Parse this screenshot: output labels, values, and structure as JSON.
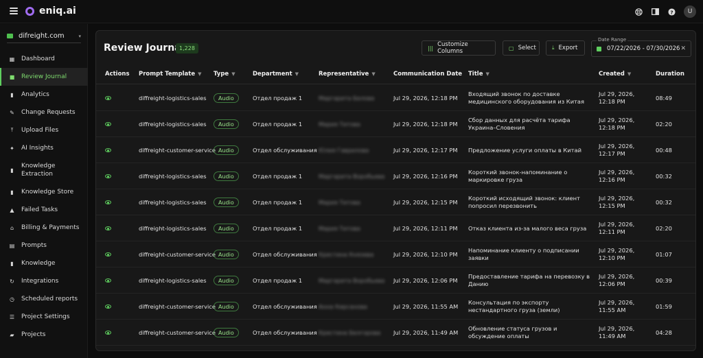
{
  "app": {
    "brand": "eniq.ai",
    "avatar_initial": "U"
  },
  "topbar_icons": [
    "support-icon",
    "split-view-icon",
    "help-icon"
  ],
  "sidebar": {
    "workspace": "difreight.com",
    "items": [
      {
        "label": "Dashboard",
        "icon": "dashboard-icon",
        "active": false
      },
      {
        "label": "Review Journal",
        "icon": "journal-icon",
        "active": true
      },
      {
        "label": "Analytics",
        "icon": "bar-chart-icon",
        "active": false
      },
      {
        "label": "Change Requests",
        "icon": "pencil-icon",
        "active": false
      },
      {
        "label": "Upload Files",
        "icon": "upload-icon",
        "active": false
      },
      {
        "label": "AI Insights",
        "icon": "sparkle-icon",
        "active": false
      },
      {
        "label": "Knowledge Extraction",
        "icon": "book-icon",
        "active": false
      },
      {
        "label": "Knowledge Store",
        "icon": "book-icon",
        "active": false
      },
      {
        "label": "Failed Tasks",
        "icon": "warning-icon",
        "active": false
      },
      {
        "label": "Billing & Payments",
        "icon": "bank-icon",
        "active": false
      },
      {
        "label": "Prompts",
        "icon": "document-icon",
        "active": false
      },
      {
        "label": "Knowledge",
        "icon": "book-icon",
        "active": false
      },
      {
        "label": "Integrations",
        "icon": "refresh-icon",
        "active": false
      },
      {
        "label": "Scheduled reports",
        "icon": "clock-icon",
        "active": false
      },
      {
        "label": "Project Settings",
        "icon": "sliders-icon",
        "active": false
      },
      {
        "label": "Projects",
        "icon": "folder-icon",
        "active": false
      }
    ]
  },
  "header": {
    "title": "Review Journal",
    "count": "1,228",
    "customize_label": "Customize Columns",
    "select_label": "Select",
    "export_label": "Export",
    "date_range_label": "Date Range",
    "date_range_value": "07/22/2026 - 07/30/2026"
  },
  "table": {
    "columns": {
      "actions": "Actions",
      "prompt_template": "Prompt Template",
      "type": "Type",
      "department": "Department",
      "representative": "Representative",
      "communication_date": "Communication Date",
      "title": "Title",
      "created": "Created",
      "duration": "Duration"
    },
    "rows": [
      {
        "prompt": "diffreight-logistics-sales",
        "type": "Audio",
        "dept": "Отдел продаж 1",
        "rep": "Маргарита Белова",
        "date": "Jul 29, 2026, 12:18 PM",
        "title": "Входящий звонок по доставке медицинского оборудования из Китая",
        "created": "Jul 29, 2026, 12:18 PM",
        "duration": "08:49"
      },
      {
        "prompt": "diffreight-logistics-sales",
        "type": "Audio",
        "dept": "Отдел продаж 1",
        "rep": "Мария Титова",
        "date": "Jul 29, 2026, 12:18 PM",
        "title": "Сбор данных для расчёта тарифа Украина–Словения",
        "created": "Jul 29, 2026, 12:18 PM",
        "duration": "02:20"
      },
      {
        "prompt": "diffreight-customer-service",
        "type": "Audio",
        "dept": "Отдел обслуживания",
        "rep": "Юлия Гаврилова",
        "date": "Jul 29, 2026, 12:17 PM",
        "title": "Предложение услуги оплаты в Китай",
        "created": "Jul 29, 2026, 12:17 PM",
        "duration": "00:48"
      },
      {
        "prompt": "diffreight-logistics-sales",
        "type": "Audio",
        "dept": "Отдел продаж 1",
        "rep": "Маргарита Воробьева",
        "date": "Jul 29, 2026, 12:16 PM",
        "title": "Короткий звонок-напоминание о маркировке груза",
        "created": "Jul 29, 2026, 12:16 PM",
        "duration": "00:32"
      },
      {
        "prompt": "diffreight-logistics-sales",
        "type": "Audio",
        "dept": "Отдел продаж 1",
        "rep": "Мария Титова",
        "date": "Jul 29, 2026, 12:15 PM",
        "title": "Короткий исходящий звонок: клиент попросил перезвонить",
        "created": "Jul 29, 2026, 12:15 PM",
        "duration": "00:32"
      },
      {
        "prompt": "diffreight-logistics-sales",
        "type": "Audio",
        "dept": "Отдел продаж 1",
        "rep": "Мария Титова",
        "date": "Jul 29, 2026, 12:11 PM",
        "title": "Отказ клиента из-за малого веса груза",
        "created": "Jul 29, 2026, 12:11 PM",
        "duration": "02:20"
      },
      {
        "prompt": "diffreight-customer-service",
        "type": "Audio",
        "dept": "Отдел обслуживания",
        "rep": "Кристина Князева",
        "date": "Jul 29, 2026, 12:10 PM",
        "title": "Напоминание клиенту о подписании заявки",
        "created": "Jul 29, 2026, 12:10 PM",
        "duration": "01:07"
      },
      {
        "prompt": "diffreight-logistics-sales",
        "type": "Audio",
        "dept": "Отдел продаж 1",
        "rep": "Маргарита Воробьева",
        "date": "Jul 29, 2026, 12:06 PM",
        "title": "Предоставление тарифа на перевозку в Данию",
        "created": "Jul 29, 2026, 12:06 PM",
        "duration": "00:39"
      },
      {
        "prompt": "diffreight-customer-service",
        "type": "Audio",
        "dept": "Отдел обслуживания",
        "rep": "Анна Кирсанова",
        "date": "Jul 29, 2026, 11:55 AM",
        "title": "Консультация по экспорту нестандартного груза (земли)",
        "created": "Jul 29, 2026, 11:55 AM",
        "duration": "01:59"
      },
      {
        "prompt": "diffreight-customer-service",
        "type": "Audio",
        "dept": "Отдел обслуживания",
        "rep": "Кристина Белгорова",
        "date": "Jul 29, 2026, 11:49 AM",
        "title": "Обновление статуса грузов и обсуждение оплаты",
        "created": "Jul 29, 2026, 11:49 AM",
        "duration": "04:28"
      }
    ]
  },
  "colors": {
    "accent": "#5fcf5f",
    "background": "#0d0d0d",
    "panel": "#181818"
  }
}
